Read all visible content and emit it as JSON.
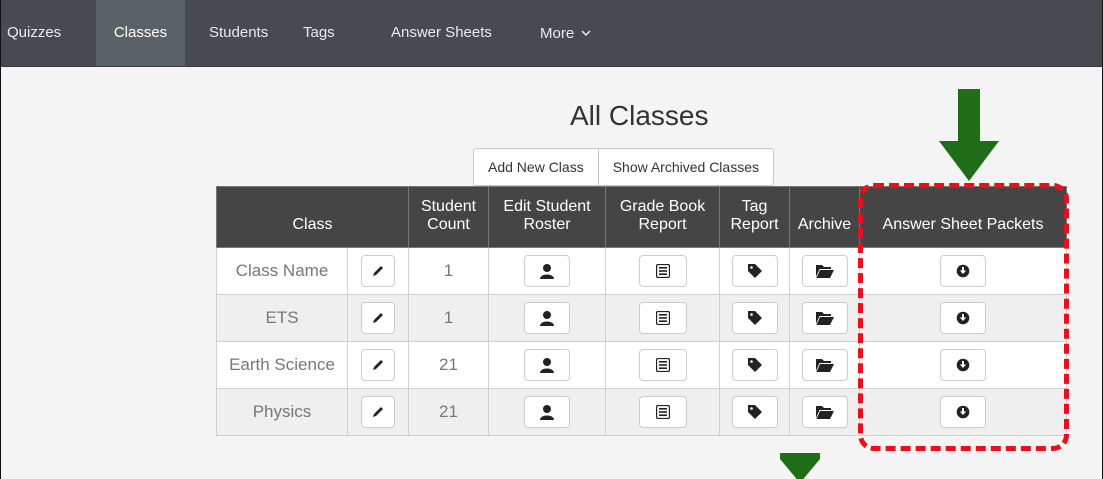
{
  "nav": {
    "items": [
      {
        "label": "Quizzes",
        "active": false
      },
      {
        "label": "Classes",
        "active": true
      },
      {
        "label": "Students",
        "active": false
      },
      {
        "label": "Tags",
        "active": false
      },
      {
        "label": "Answer Sheets",
        "active": false
      },
      {
        "label": "More",
        "active": false,
        "icon": "chevron-down-icon"
      }
    ]
  },
  "page": {
    "title": "All Classes",
    "actions": {
      "add_new_class": "Add New Class",
      "show_archived_classes": "Show Archived Classes"
    }
  },
  "table": {
    "headers": {
      "class": "Class",
      "student_count_1": "Student",
      "student_count_2": "Count",
      "edit_roster_1": "Edit Student",
      "edit_roster_2": "Roster",
      "grade_book_1": "Grade Book",
      "grade_book_2": "Report",
      "tag_report_1": "Tag",
      "tag_report_2": "Report",
      "archive": "Archive",
      "answer_sheet_packets": "Answer Sheet Packets"
    },
    "rows": [
      {
        "name": "Class Name",
        "count": "1"
      },
      {
        "name": "ETS",
        "count": "1"
      },
      {
        "name": "Earth Science",
        "count": "21"
      },
      {
        "name": "Physics",
        "count": "21"
      }
    ],
    "row_icons": {
      "edit": "pencil-icon",
      "roster": "user-icon",
      "grade_book": "list-alt-icon",
      "tag": "tag-icon",
      "archive": "folder-open-icon",
      "packet": "download-circle-icon"
    }
  },
  "annotations": {
    "highlight_color": "#e8101a",
    "arrow_color": "#1f6e17"
  }
}
